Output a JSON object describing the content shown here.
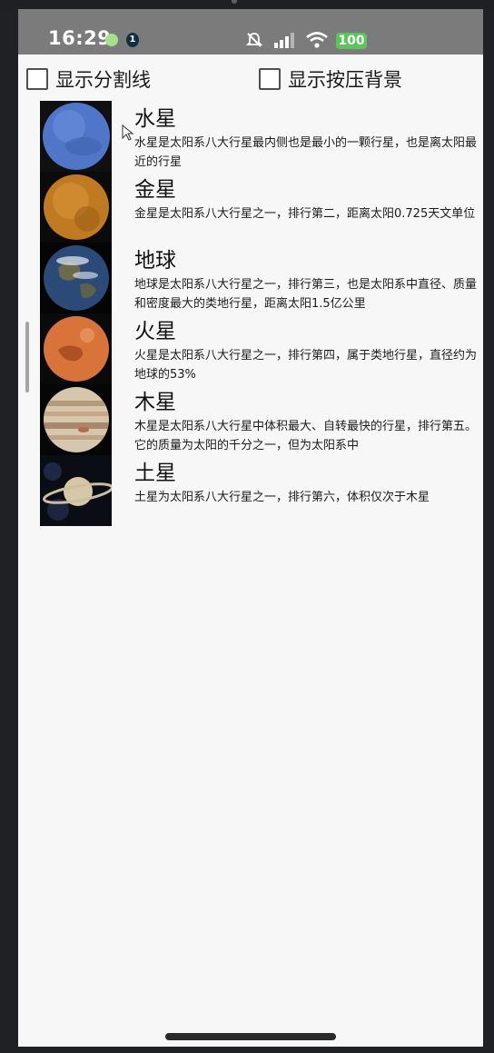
{
  "status_bar": {
    "time": "16:29",
    "app_badge": "1",
    "battery": "100"
  },
  "options": {
    "show_divider_label": "显示分割线",
    "show_pressed_bg_label": "显示按压背景"
  },
  "planets": [
    {
      "name": "水星",
      "desc": "水星是太阳系八大行星最内侧也是最小的一颗行星，也是离太阳最近的行星"
    },
    {
      "name": "金星",
      "desc": "金星是太阳系八大行星之一，排行第二，距离太阳0.725天文单位"
    },
    {
      "name": "地球",
      "desc": "地球是太阳系八大行星之一，排行第三，也是太阳系中直径、质量和密度最大的类地行星，距离太阳1.5亿公里"
    },
    {
      "name": "火星",
      "desc": "火星是太阳系八大行星之一，排行第四，属于类地行星，直径约为地球的53%"
    },
    {
      "name": "木星",
      "desc": "木星是太阳系八大行星中体积最大、自转最快的行星，排行第五。它的质量为太阳的千分之一，但为太阳系中"
    },
    {
      "name": "土星",
      "desc": "土星为太阳系八大行星之一，排行第六，体积仅次于木星"
    }
  ]
}
